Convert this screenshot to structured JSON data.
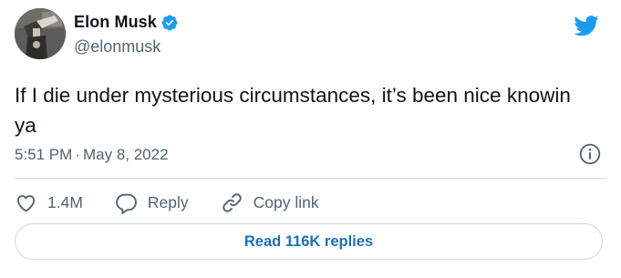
{
  "author": {
    "display_name": "Elon Musk",
    "handle": "@elonmusk",
    "verified": true
  },
  "tweet": {
    "text": "If I die under mysterious circumstances, it’s been nice knowin ya",
    "time": "5:51 PM",
    "separator": "·",
    "date": "May 8, 2022"
  },
  "actions": {
    "likes": "1.4M",
    "reply_label": "Reply",
    "copy_link_label": "Copy link"
  },
  "read_replies_label": "Read 116K replies",
  "icons": {
    "brand": "twitter-bird-icon",
    "verified": "verified-badge-icon",
    "info": "info-icon",
    "like": "heart-icon",
    "reply": "reply-bubble-icon",
    "copy_link": "link-icon"
  },
  "colors": {
    "brand_blue": "#1d9bf0",
    "text_primary": "#0f1419",
    "text_secondary": "#536471",
    "border": "#cfd9de",
    "link": "#1d71b8"
  }
}
